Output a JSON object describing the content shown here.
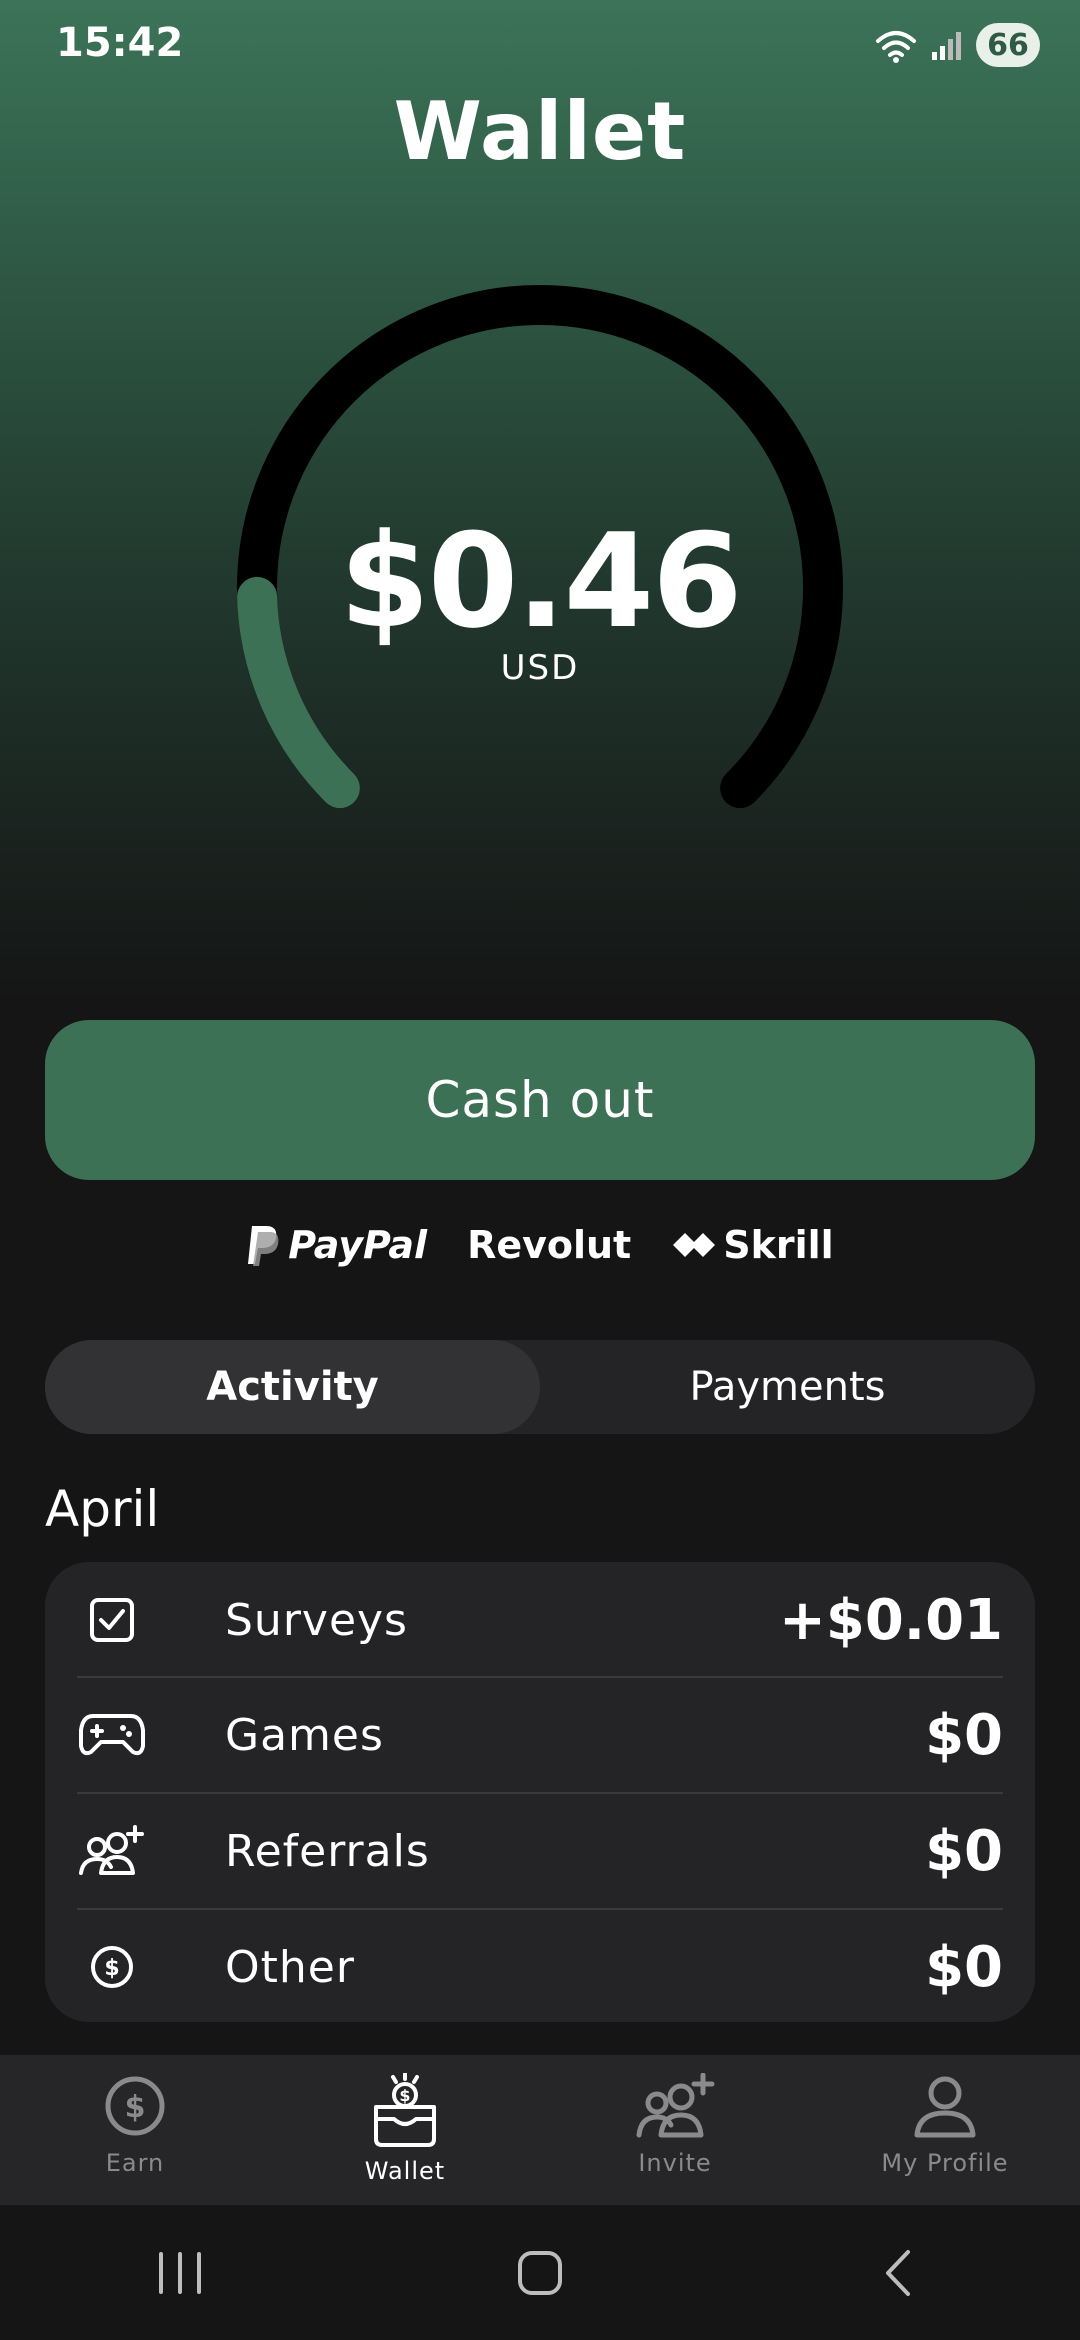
{
  "status": {
    "time": "15:42",
    "battery": "66"
  },
  "page": {
    "title": "Wallet"
  },
  "balance": {
    "amount": "$0.46",
    "currency": "USD",
    "progress_fraction": 0.16
  },
  "cashout": {
    "label": "Cash out"
  },
  "providers": [
    "PayPal",
    "Revolut",
    "Skrill"
  ],
  "tabs": [
    {
      "label": "Activity",
      "active": true
    },
    {
      "label": "Payments",
      "active": false
    }
  ],
  "activity": {
    "month": "April",
    "rows": [
      {
        "label": "Surveys",
        "value": "+$0.01",
        "icon": "checkbox-icon"
      },
      {
        "label": "Games",
        "value": "$0",
        "icon": "gamepad-icon"
      },
      {
        "label": "Referrals",
        "value": "$0",
        "icon": "add-user-icon"
      },
      {
        "label": "Other",
        "value": "$0",
        "icon": "dollar-circle-icon"
      }
    ]
  },
  "nav": [
    {
      "label": "Earn",
      "icon": "dollar-circle-icon",
      "active": false
    },
    {
      "label": "Wallet",
      "icon": "wallet-icon",
      "active": true
    },
    {
      "label": "Invite",
      "icon": "add-user-icon",
      "active": false
    },
    {
      "label": "My Profile",
      "icon": "profile-icon",
      "active": false
    }
  ],
  "colors": {
    "accent": "#3c7156",
    "gauge_track": "#000000",
    "card_bg": "#242426"
  }
}
